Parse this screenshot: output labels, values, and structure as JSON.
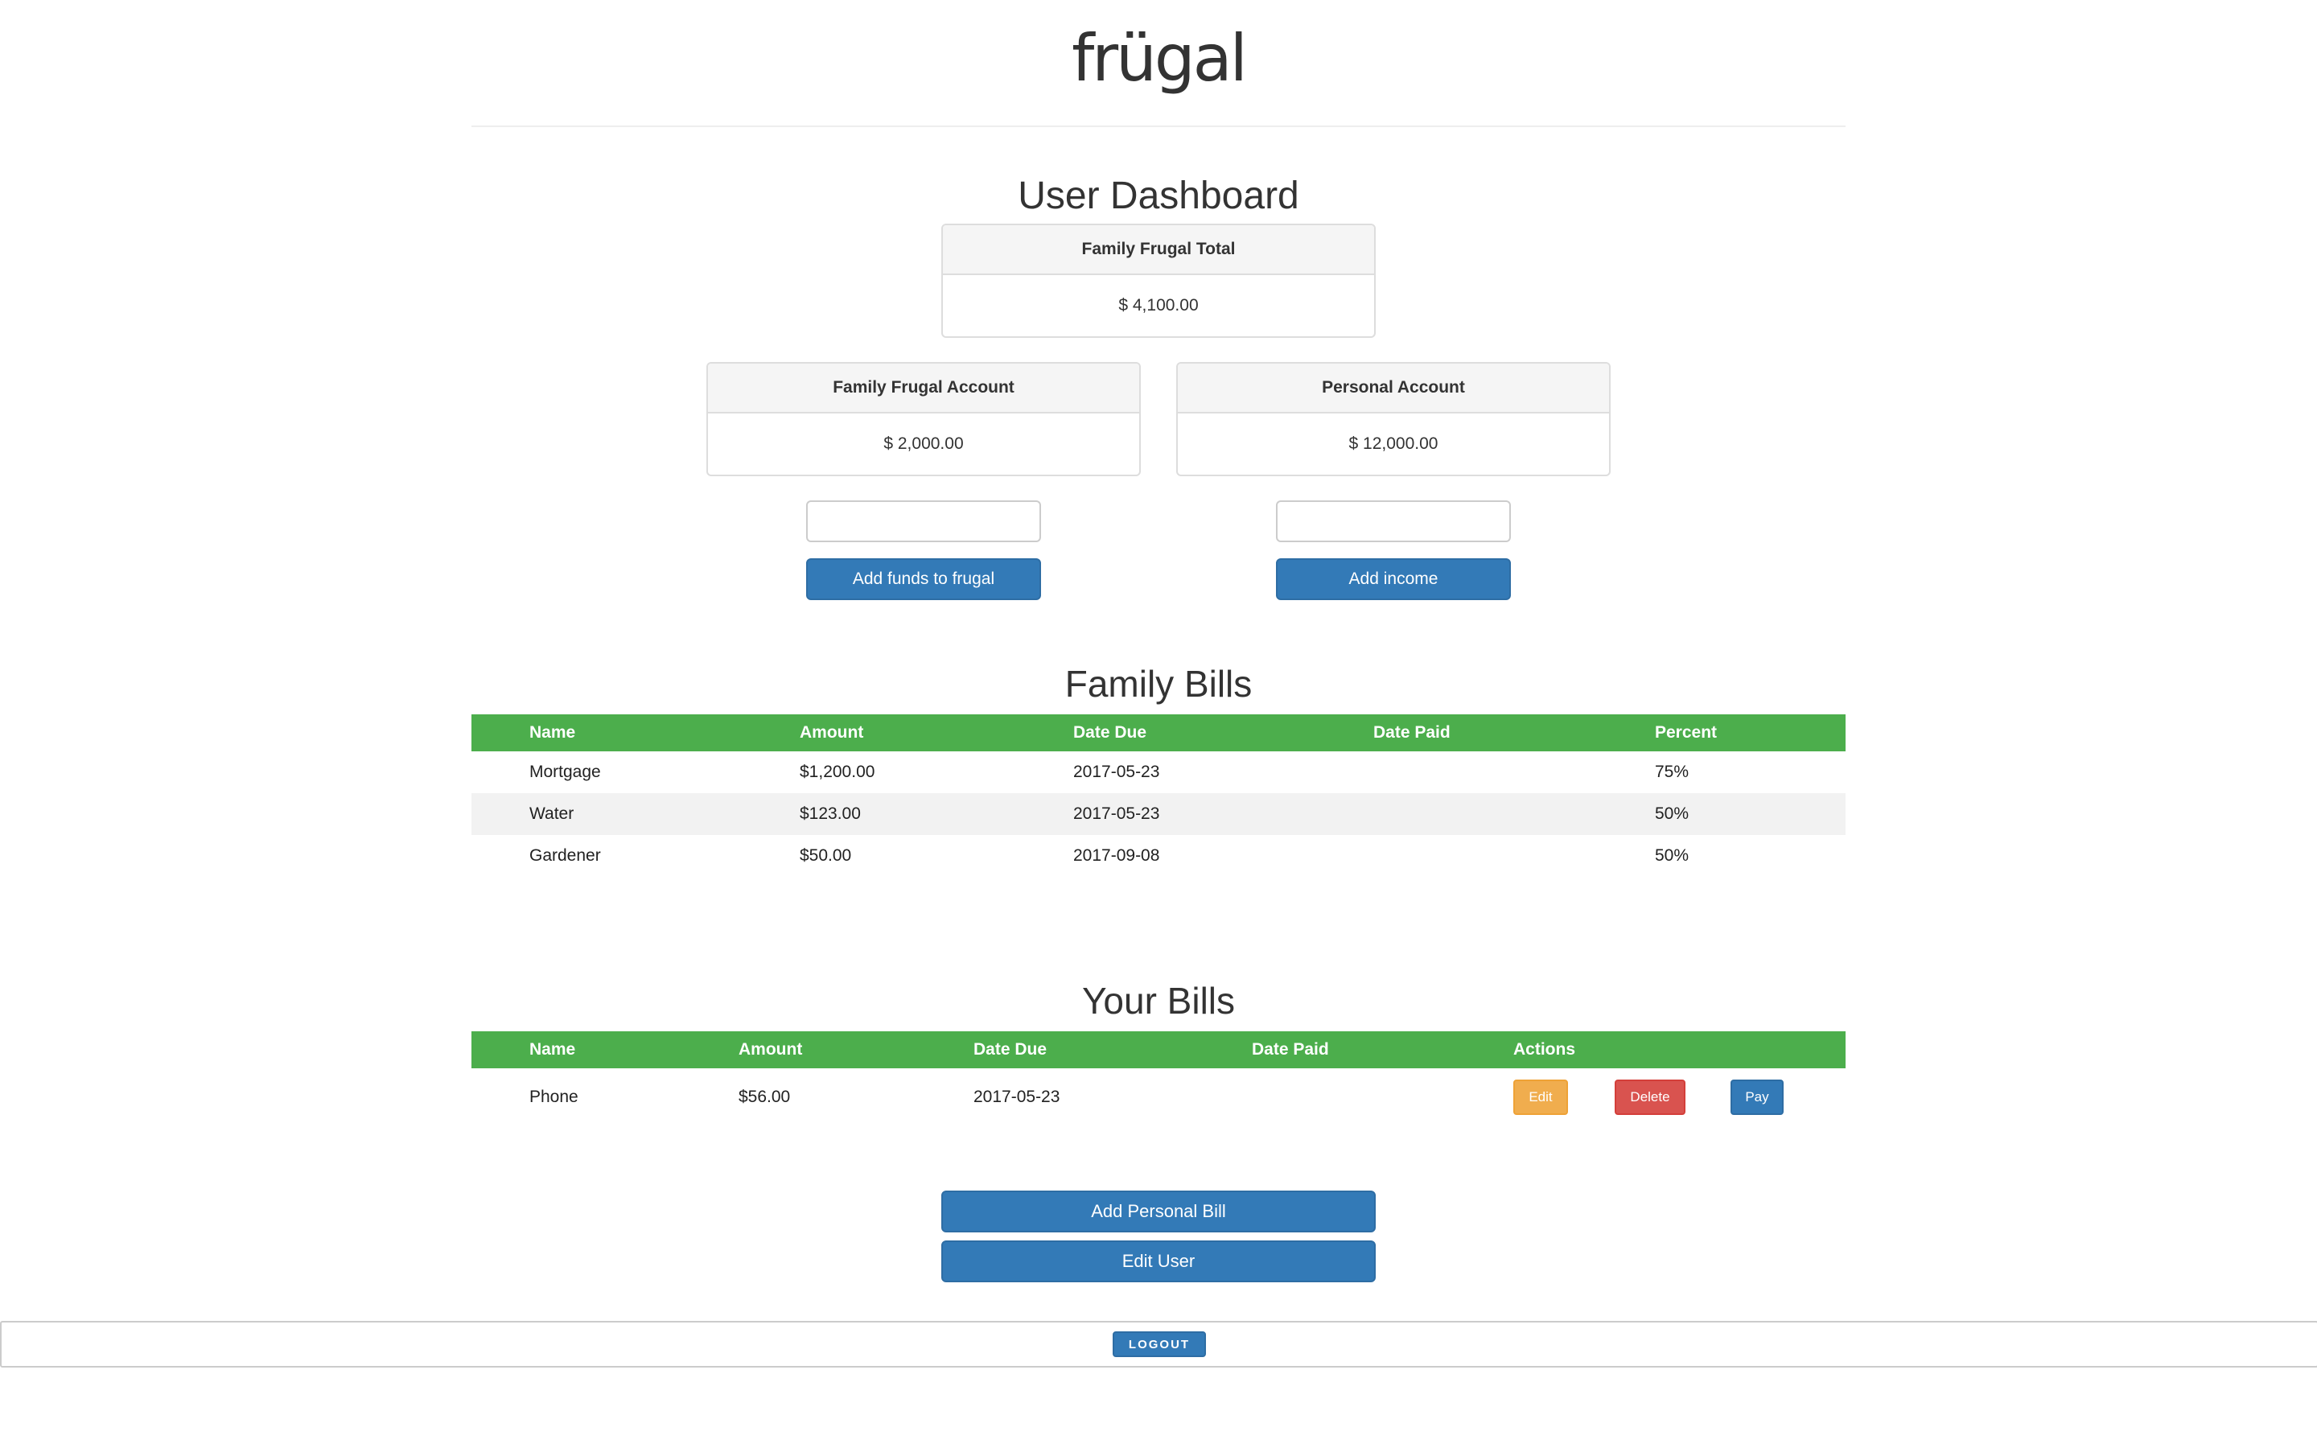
{
  "header": {
    "brand": "frügal"
  },
  "dashboard": {
    "title": "User Dashboard",
    "total": {
      "label": "Family Frugal Total",
      "amount": "$ 4,100.00"
    },
    "family_account": {
      "label": "Family Frugal Account",
      "amount": "$ 2,000.00",
      "input_value": "",
      "button_label": "Add funds to frugal"
    },
    "personal_account": {
      "label": "Personal Account",
      "amount": "$ 12,000.00",
      "input_value": "",
      "button_label": "Add income"
    }
  },
  "family_bills": {
    "title": "Family Bills",
    "columns": [
      "Name",
      "Amount",
      "Date Due",
      "Date Paid",
      "Percent"
    ],
    "rows": [
      {
        "name": "Mortgage",
        "amount": "$1,200.00",
        "date_due": "2017-05-23",
        "date_paid": "",
        "percent": "75%"
      },
      {
        "name": "Water",
        "amount": "$123.00",
        "date_due": "2017-05-23",
        "date_paid": "",
        "percent": "50%"
      },
      {
        "name": "Gardener",
        "amount": "$50.00",
        "date_due": "2017-09-08",
        "date_paid": "",
        "percent": "50%"
      }
    ]
  },
  "your_bills": {
    "title": "Your Bills",
    "columns": [
      "Name",
      "Amount",
      "Date Due",
      "Date Paid",
      "Actions"
    ],
    "rows": [
      {
        "name": "Phone",
        "amount": "$56.00",
        "date_due": "2017-05-23",
        "date_paid": "",
        "edit_label": "Edit",
        "delete_label": "Delete",
        "pay_label": "Pay"
      }
    ]
  },
  "actions": {
    "add_personal_bill": "Add Personal Bill",
    "edit_user": "Edit User"
  },
  "footer": {
    "logout_label": "LOGOUT"
  },
  "colors": {
    "primary": "#337ab7",
    "success": "#4cae4c",
    "warning": "#f0ad4e",
    "danger": "#d9534f"
  }
}
